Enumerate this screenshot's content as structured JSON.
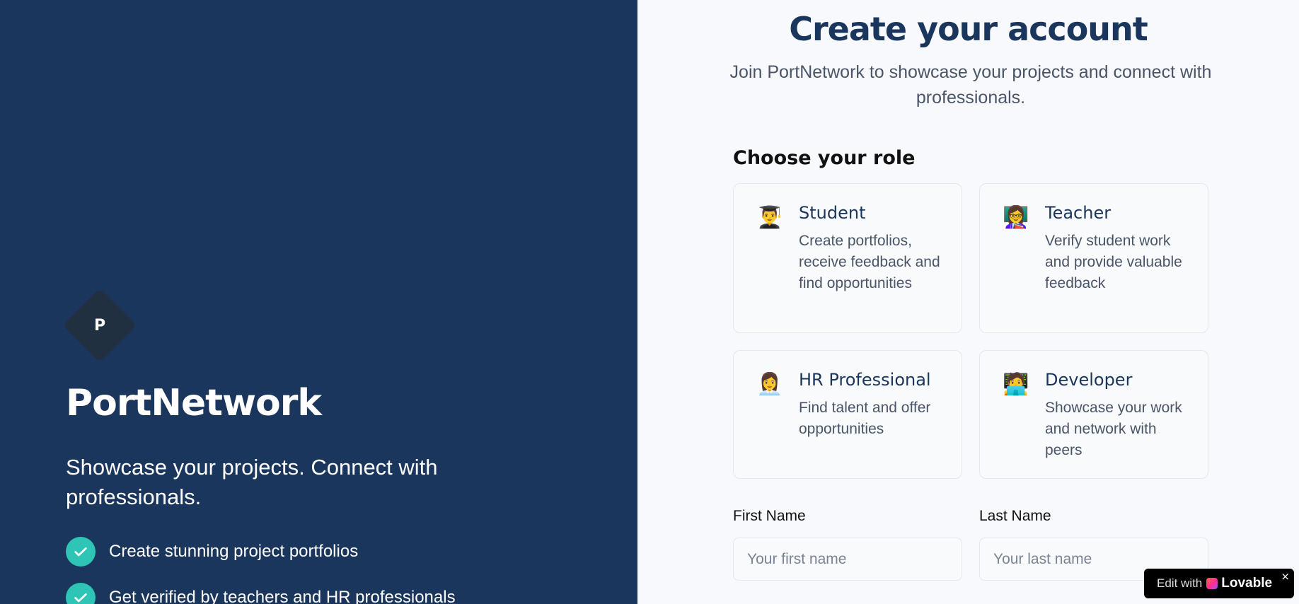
{
  "left": {
    "logo_letter": "P",
    "brand": "PortNetwork",
    "tagline": "Showcase your projects. Connect with professionals.",
    "features": [
      "Create stunning project portfolios",
      "Get verified by teachers and HR professionals"
    ]
  },
  "right": {
    "title": "Create your account",
    "subtitle": "Join PortNetwork to showcase your projects and connect with professionals.",
    "role_heading": "Choose your role",
    "roles": [
      {
        "icon": "student-emoji-icon",
        "glyph": "👨‍🎓",
        "title": "Student",
        "description": "Create portfolios, receive feedback and find opportunities"
      },
      {
        "icon": "teacher-emoji-icon",
        "glyph": "👩‍🏫",
        "title": "Teacher",
        "description": "Verify student work and provide valuable feedback"
      },
      {
        "icon": "hr-professional-emoji-icon",
        "glyph": "👩‍💼",
        "title": "HR Professional",
        "description": "Find talent and offer opportunities"
      },
      {
        "icon": "developer-emoji-icon",
        "glyph": "🧑‍💻",
        "title": "Developer",
        "description": "Showcase your work and network with peers"
      }
    ],
    "first_name": {
      "label": "First Name",
      "placeholder": "Your first name",
      "value": ""
    },
    "last_name": {
      "label": "Last Name",
      "placeholder": "Your last name",
      "value": ""
    }
  },
  "badge": {
    "edit_text": "Edit with",
    "brand": "Lovable",
    "close": "×"
  },
  "colors": {
    "left_bg": "#1b365d",
    "right_bg": "#f7f9fc",
    "accent_check": "#2ec4b6",
    "heading": "#1b365d"
  }
}
